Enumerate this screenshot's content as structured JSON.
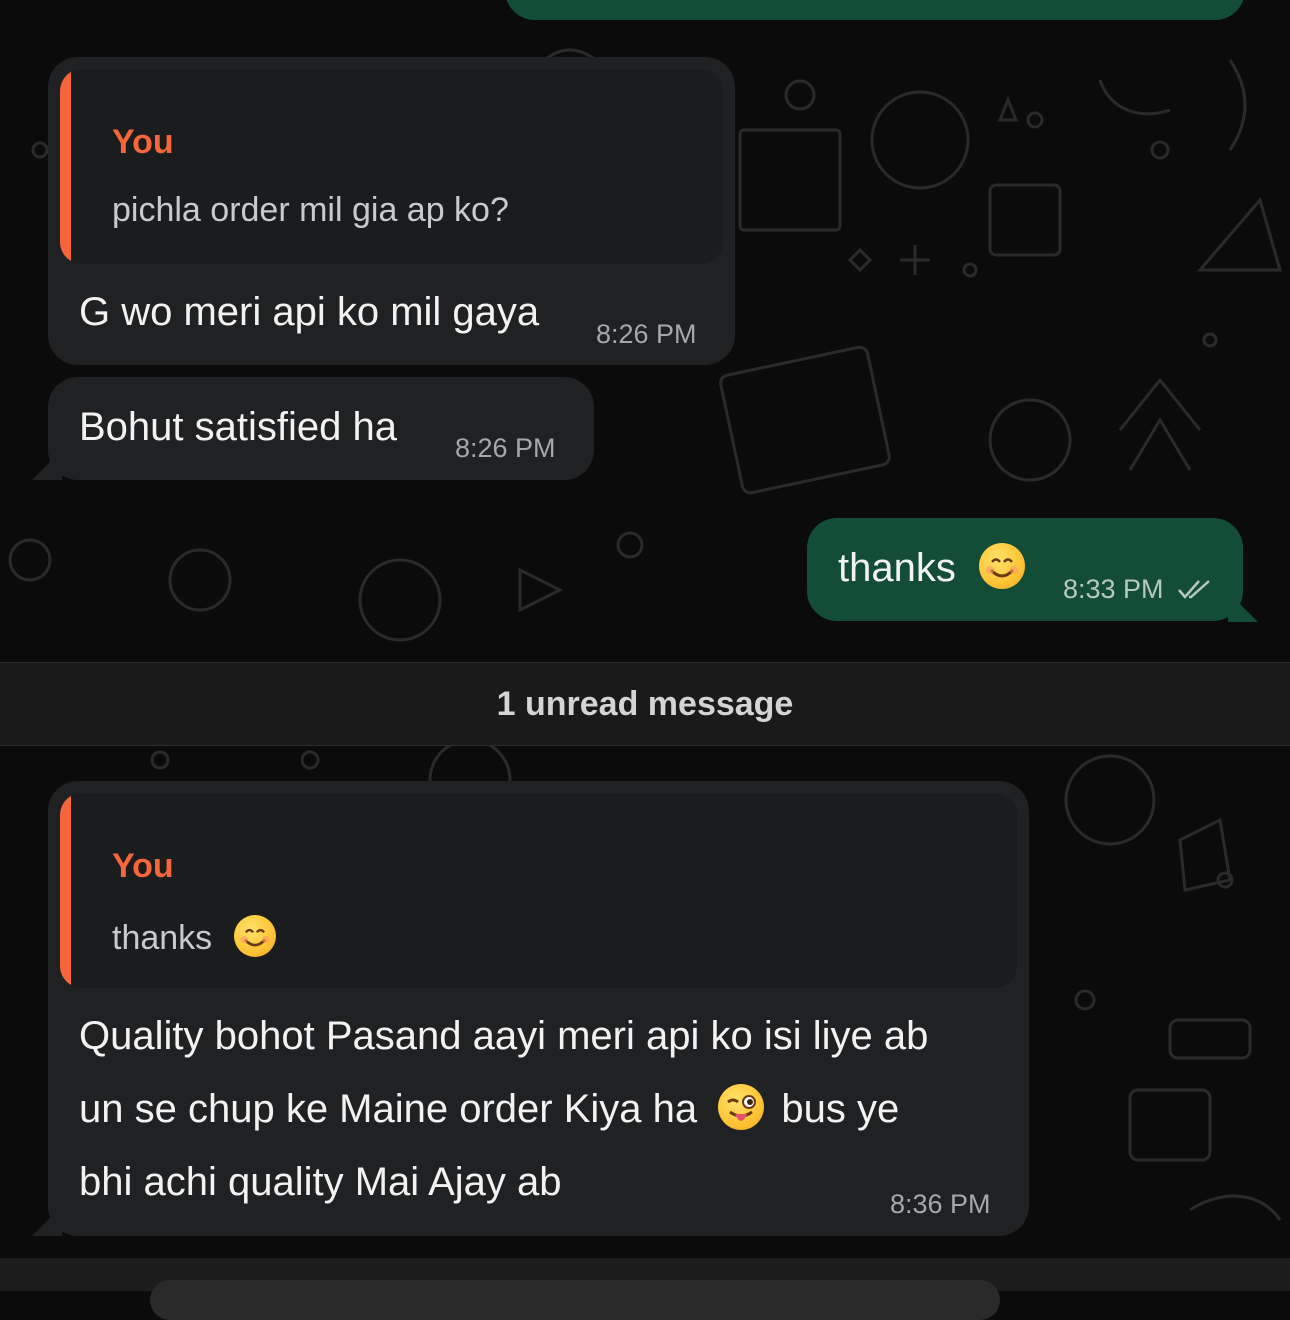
{
  "chat": {
    "msg1": {
      "quote_author": "You",
      "quote_text": "pichla order mil gia ap ko?",
      "text": "G wo meri api ko mil gaya",
      "time": "8:26 PM"
    },
    "msg2": {
      "text": "Bohut satisfied ha",
      "time": "8:26 PM"
    },
    "msg3": {
      "text": "thanks",
      "emoji": "smiling-face",
      "time": "8:33 PM",
      "status_icon": "double-check-icon"
    },
    "divider": "1 unread message",
    "msg4": {
      "quote_author": "You",
      "quote_text": "thanks",
      "quote_emoji": "smiling-face",
      "line1": "Quality bohot Pasand aayi meri api ko isi liye ab",
      "line2_a": "un se chup ke Maine order Kiya ha",
      "line2_emoji": "winking-tongue-face",
      "line2_b": "bus ye",
      "line3": "bhi achi quality Mai Ajay ab",
      "time": "8:36 PM"
    }
  },
  "colors": {
    "incoming_bubble": "#1f2123",
    "outgoing_bubble": "#134d37",
    "quote_accent": "#f7663a",
    "background": "#0b0b0b"
  }
}
